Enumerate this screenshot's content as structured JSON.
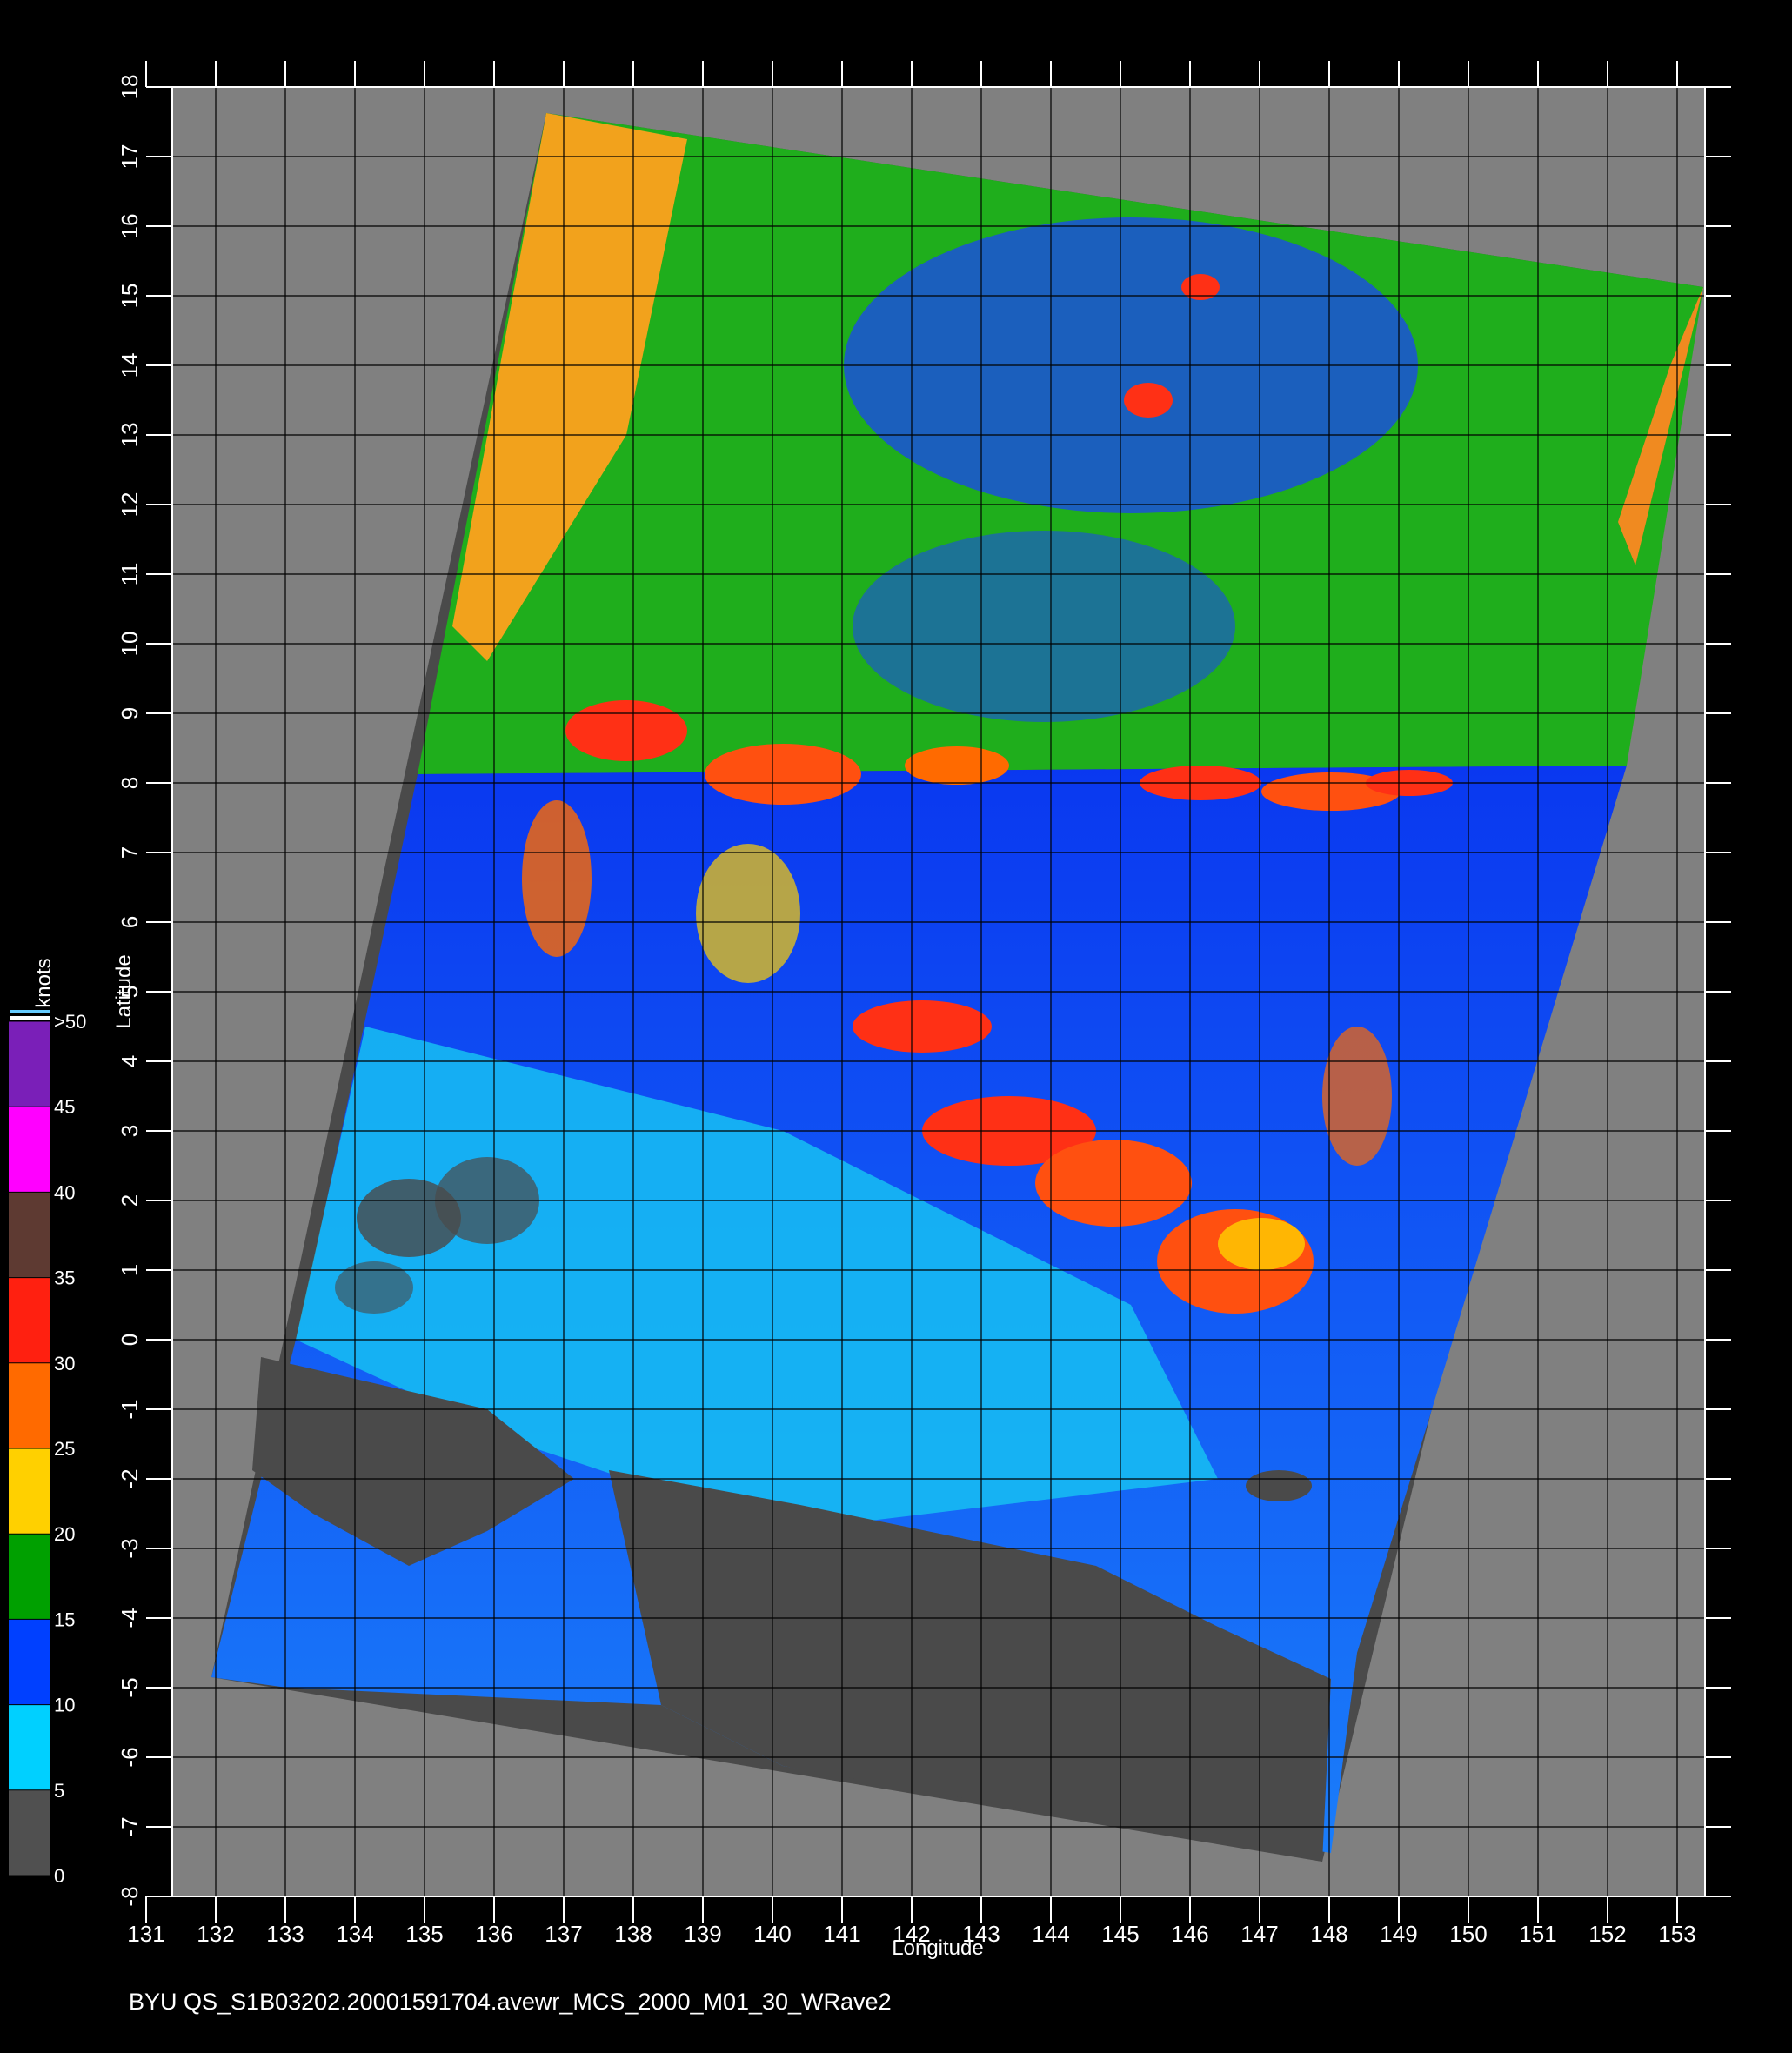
{
  "caption": "BYU  QS_S1B03202.20001591704.avewr_MCS_2000_M01_30_WRave2",
  "axes": {
    "xlabel": "Longitude",
    "ylabel": "Latitude",
    "lon_ticks": [
      "131",
      "132",
      "133",
      "134",
      "135",
      "136",
      "137",
      "138",
      "139",
      "140",
      "141",
      "142",
      "143",
      "144",
      "145",
      "146",
      "147",
      "148",
      "149",
      "150",
      "151",
      "152",
      "153"
    ],
    "lat_ticks": [
      "18",
      "17",
      "16",
      "15",
      "14",
      "13",
      "12",
      "11",
      "10",
      "9",
      "8",
      "7",
      "6",
      "5",
      "4",
      "3",
      "2",
      "1",
      "0",
      "-1",
      "-2",
      "-3",
      "-4",
      "-5",
      "-6",
      "-7",
      "-8"
    ]
  },
  "colorbar": {
    "title": "knots",
    "labels": [
      ">50",
      "45",
      "40",
      "35",
      "30",
      "25",
      "20",
      "15",
      "10",
      "5",
      "0"
    ],
    "colors": [
      "#7a1fb8",
      "#ff00ff",
      "#5e3a32",
      "#ff2010",
      "#ff6a00",
      "#ffd000",
      "#00a000",
      "#0040ff",
      "#00d0ff",
      "#505050"
    ]
  },
  "colors": {
    "background": "#000000",
    "no_data": "#808080",
    "land": "#4a4a4a",
    "grid": "#000000"
  }
}
